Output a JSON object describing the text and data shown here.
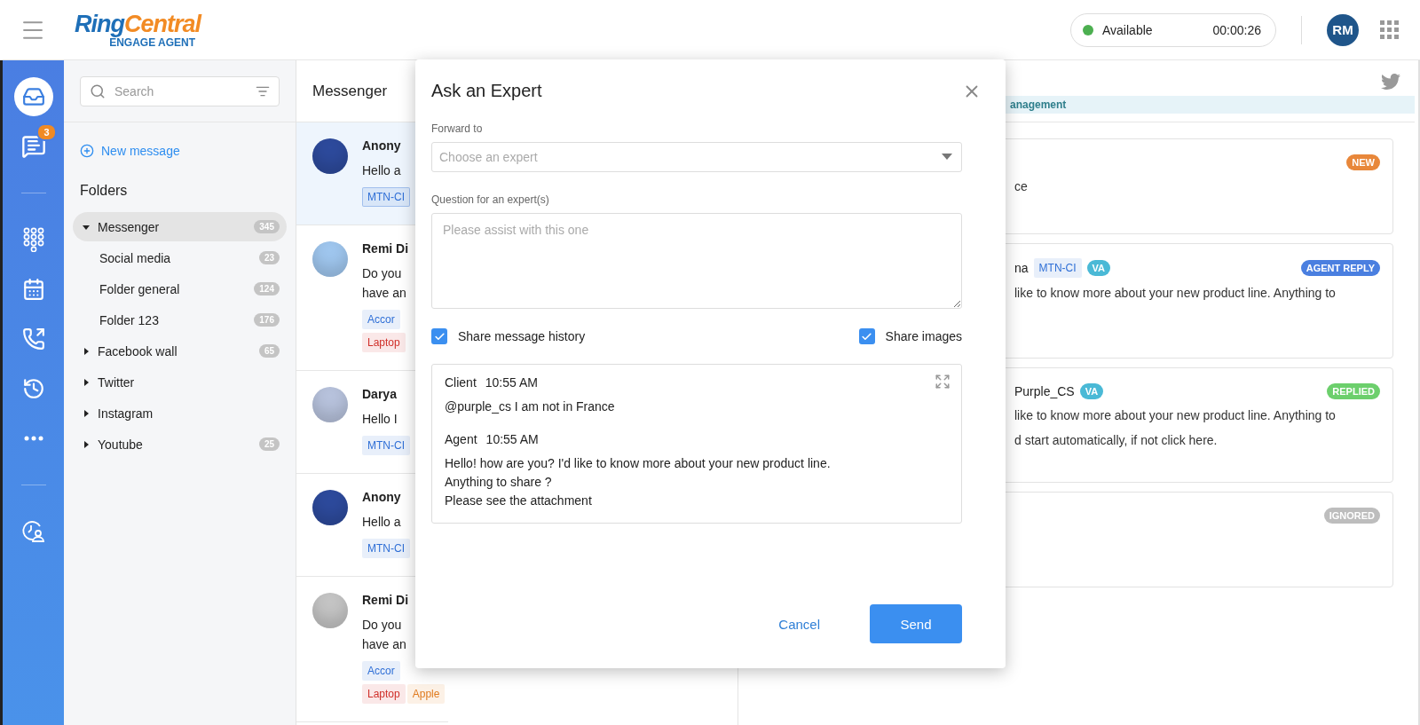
{
  "header": {
    "brand_first": "Ring",
    "brand_second": "Central",
    "product": "ENGAGE AGENT",
    "status": {
      "label": "Available",
      "color": "#4caf50",
      "timer": "00:00:26"
    },
    "avatar": "RM"
  },
  "rail": {
    "groups": [
      [
        {
          "selected": true
        },
        {
          "selected": false,
          "badge": "3"
        }
      ],
      [
        {
          "selected": false
        },
        {
          "selected": false
        },
        {
          "selected": false
        },
        {
          "selected": false
        },
        {
          "selected": false
        }
      ],
      [
        {
          "selected": false
        }
      ]
    ]
  },
  "folders": {
    "search_placeholder": "Search",
    "new_message": "New message",
    "title": "Folders",
    "items": [
      {
        "label": "Messenger",
        "count": "345",
        "expanded": true,
        "selected": true,
        "children": [
          {
            "label": "Social media",
            "count": "23",
            "selected": false
          },
          {
            "label": "Folder general",
            "count": "124",
            "selected": false
          },
          {
            "label": "Folder 123",
            "count": "176",
            "selected": false
          }
        ]
      },
      {
        "label": "Facebook wall",
        "count": "65",
        "expanded": false,
        "selected": false
      },
      {
        "label": "Twitter",
        "expanded": false,
        "selected": false
      },
      {
        "label": "Instagram",
        "expanded": false,
        "selected": false
      },
      {
        "label": "Youtube",
        "count": "25",
        "expanded": false,
        "selected": false
      }
    ]
  },
  "list": {
    "title": "Messenger",
    "rows": [
      {
        "name": "Anony",
        "lines": [
          "Hello a"
        ],
        "color": "#2d4a9c",
        "selected": true,
        "tag_rows": [
          [
            {
              "label": "MTN-CI",
              "color": "#2f6fd6"
            }
          ]
        ]
      },
      {
        "name": "Remi Di",
        "lines": [
          "Do you",
          "have an"
        ],
        "color": "#9fc6ee",
        "selected": false,
        "tag_rows": [
          [
            {
              "label": "Accor",
              "color": "#2f6fd6"
            }
          ],
          [
            {
              "label": "Laptop",
              "color": "#d0302a"
            }
          ]
        ]
      },
      {
        "name": "Darya",
        "lines": [
          "Hello I"
        ],
        "color": "#b7c2dc",
        "selected": false,
        "tag_rows": [
          [
            {
              "label": "MTN-CI",
              "color": "#2f6fd6"
            }
          ]
        ]
      },
      {
        "name": "Anony",
        "lines": [
          "Hello a"
        ],
        "color": "#2d4a9c",
        "selected": false,
        "tag_rows": [
          [
            {
              "label": "MTN-CI",
              "color": "#2f6fd6"
            }
          ]
        ]
      },
      {
        "name": "Remi Di",
        "lines": [
          "Do you",
          "have an"
        ],
        "color": "#c4c4c4",
        "selected": false,
        "tag_rows": [
          [
            {
              "label": "Accor",
              "color": "#2f6fd6"
            }
          ],
          [
            {
              "label": "Laptop",
              "color": "#d0302a"
            },
            {
              "label": "Apple",
              "color": "#e07b1f"
            }
          ]
        ]
      }
    ]
  },
  "right": {
    "strip_tag": "anagement",
    "cards": [
      {
        "badge": {
          "label": "NEW",
          "color": "#e8873a"
        },
        "lines": [
          "ce"
        ]
      },
      {
        "author": "na",
        "tag": {
          "label": "MTN-CI",
          "color": "#2f6fd6"
        },
        "va": "VA",
        "badge": {
          "label": "AGENT REPLY",
          "color": "#4a7fe0"
        },
        "lines": [
          "like to know more about your new product line. Anything to"
        ]
      },
      {
        "author": "Purple_CS",
        "va": "VA",
        "badge": {
          "label": "REPLIED",
          "color": "#6ccf6c"
        },
        "lines": [
          "like to know more about your new product line. Anything to",
          "d start automatically, if not click here."
        ]
      },
      {
        "badge": {
          "label": "IGNORED",
          "color": "#bdbdbd"
        }
      }
    ]
  },
  "modal": {
    "title": "Ask an Expert",
    "forward_label": "Forward to",
    "forward_placeholder": "Choose an expert",
    "question_label": "Question for an expert(s)",
    "question_placeholder": "Please assist with this one",
    "options": [
      {
        "label": "Share message history",
        "checked": true
      },
      {
        "label": "Share images",
        "checked": true
      }
    ],
    "history": [
      {
        "author": "Client",
        "time": "10:55 AM",
        "lines": [
          "@purple_cs I am not in France"
        ]
      },
      {
        "author": "Agent",
        "time": "10:55 AM",
        "lines": [
          "Hello! how are you? I'd like to know more about your new product line.",
          "Anything to share ?",
          "Please see the attachment"
        ]
      }
    ],
    "cancel": "Cancel",
    "send": "Send"
  }
}
